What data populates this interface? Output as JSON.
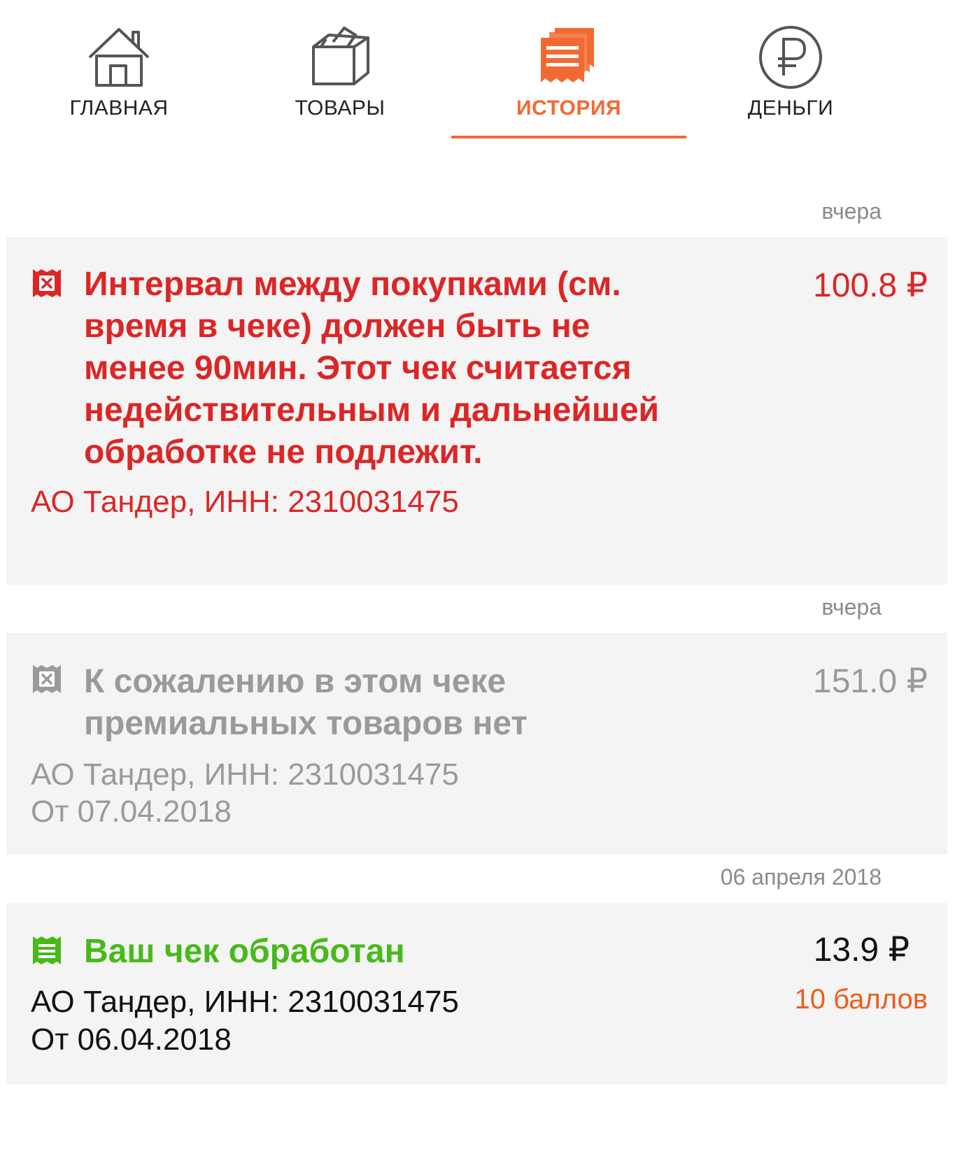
{
  "nav": {
    "tabs": [
      {
        "label": "ГЛАВНАЯ",
        "icon": "home-icon"
      },
      {
        "label": "ТОВАРЫ",
        "icon": "box-icon"
      },
      {
        "label": "ИСТОРИЯ",
        "icon": "receipts-icon"
      },
      {
        "label": "ДЕНЬГИ",
        "icon": "ruble-icon"
      }
    ],
    "active_index": 2,
    "active_color": "#f26a33",
    "inactive_color": "#222222"
  },
  "history": [
    {
      "date": "вчера",
      "status": "rejected",
      "status_color": "#dc2626",
      "icon": "rejected-receipt-icon",
      "title_lines": [
        "Интервал между покупками (см.",
        "время в чеке) должен быть не",
        "менее 90мин. Этот чек считается",
        "недействительным и дальнейшей",
        "обработке не подлежит."
      ],
      "amount": "100.8 ₽",
      "store": "АО Тандер, ИНН: 2310031475"
    },
    {
      "date": "вчера",
      "status": "no-bonus",
      "status_color": "#9a9a9a",
      "icon": "rejected-receipt-icon",
      "title_lines": [
        "К сожалению в этом чеке",
        "премиальных товаров нет"
      ],
      "amount": "151.0 ₽",
      "store": "АО  Тандер, ИНН: 2310031475",
      "purchase_date": "От 07.04.2018"
    },
    {
      "date": "06 апреля 2018",
      "status": "processed",
      "status_color": "#48b91a",
      "icon": "processed-receipt-icon",
      "title_lines": [
        "Ваш чек обработан"
      ],
      "amount": "13.9 ₽",
      "points": "10 баллов",
      "points_color": "#f25b16",
      "store": "АО Тандер, ИНН: 2310031475",
      "purchase_date": "От 06.04.2018"
    }
  ]
}
